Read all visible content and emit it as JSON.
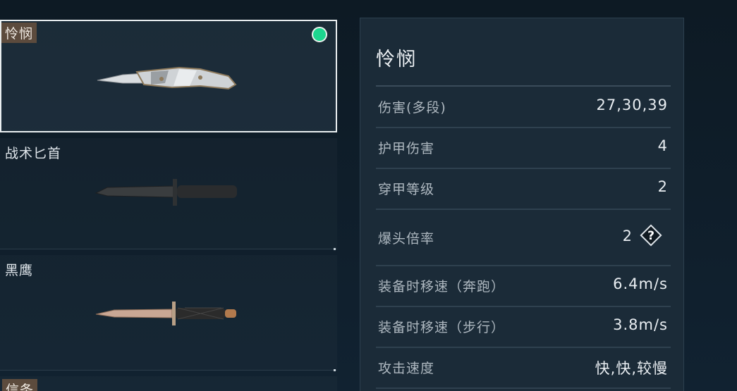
{
  "weapons": [
    {
      "name": "怜悯",
      "selected": true,
      "equipped": true
    },
    {
      "name": "战术匕首"
    },
    {
      "name": "黑鹰"
    },
    {
      "name": "信条"
    }
  ],
  "details": {
    "title": "怜悯",
    "stats": [
      {
        "label": "伤害(多段)",
        "value": "27,30,39"
      },
      {
        "label": "护甲伤害",
        "value": "4"
      },
      {
        "label": "穿甲等级",
        "value": "2"
      },
      {
        "label": "爆头倍率",
        "value": "2",
        "help_icon": "question-icon"
      },
      {
        "label": "装备时移速（奔跑）",
        "value": "6.4m/s"
      },
      {
        "label": "装备时移速（步行）",
        "value": "3.8m/s"
      },
      {
        "label": "攻击速度",
        "value": "快,快,较慢"
      }
    ]
  },
  "colors": {
    "equipped": "#1dd68f",
    "selected_border": "#e9eef0",
    "name_tag": "#5c4b3d"
  }
}
